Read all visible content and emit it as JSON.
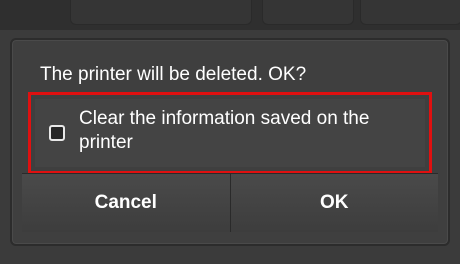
{
  "dialog": {
    "message": "The printer will be deleted. OK?",
    "option": {
      "label": "Clear the information saved on the printer",
      "checked": false
    },
    "buttons": {
      "cancel": "Cancel",
      "ok": "OK"
    }
  },
  "colors": {
    "highlight": "#e01010",
    "dialog_bg": "#3f3f3f",
    "text": "#ffffff"
  }
}
